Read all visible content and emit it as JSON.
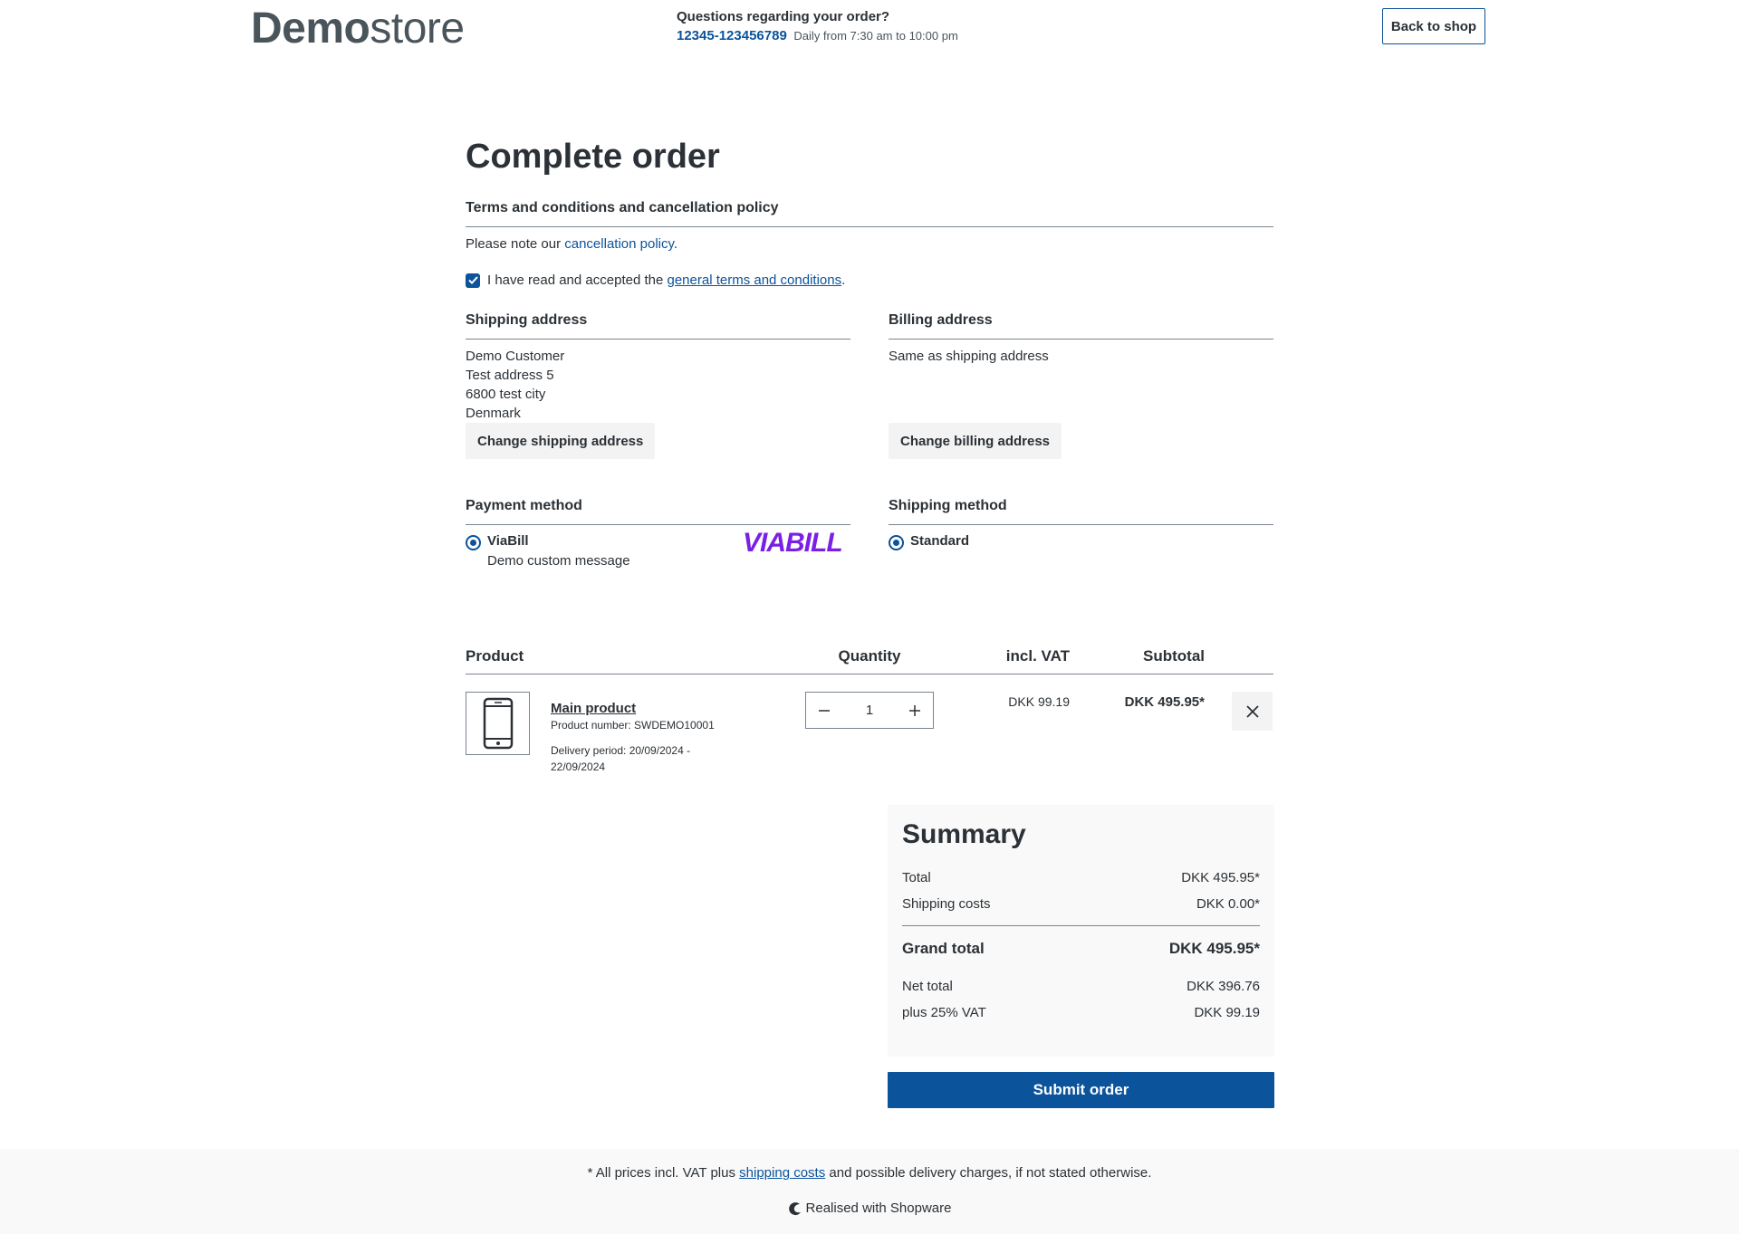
{
  "header": {
    "logo_bold": "Demo",
    "logo_light": "store",
    "hotline_title": "Questions regarding your order?",
    "hotline_phone": "12345-123456789",
    "hotline_hours": "Daily from 7:30 am to 10:00 pm",
    "back_to_shop": "Back to shop"
  },
  "page": {
    "title": "Complete order"
  },
  "terms": {
    "title": "Terms and conditions and cancellation policy",
    "note_prefix": "Please note our ",
    "cancellation_link": "cancellation policy",
    "note_suffix": ".",
    "accept_prefix": "I have read and accepted the ",
    "terms_link": "general terms and conditions",
    "accept_suffix": ".",
    "accepted": true
  },
  "shipping_address": {
    "title": "Shipping address",
    "lines": [
      "Demo Customer",
      "Test address 5",
      "6800 test city",
      "Denmark"
    ],
    "change_button": "Change shipping address"
  },
  "billing_address": {
    "title": "Billing address",
    "text": "Same as shipping address",
    "change_button": "Change billing address"
  },
  "payment": {
    "title": "Payment method",
    "method_name": "ViaBill",
    "method_message": "Demo custom message",
    "logo_text": "VIABILL",
    "logo_color": "#7b1fe6"
  },
  "shipping_method": {
    "title": "Shipping method",
    "method_name": "Standard"
  },
  "cart": {
    "headers": {
      "product": "Product",
      "quantity": "Quantity",
      "incl_vat": "incl. VAT",
      "subtotal": "Subtotal"
    },
    "items": [
      {
        "name": "Main product",
        "product_number": "Product number: SWDEMO10001",
        "delivery_line1": "Delivery period: 20/09/2024 -",
        "delivery_line2": "22/09/2024",
        "quantity": "1",
        "vat": "DKK 99.19",
        "subtotal": "DKK 495.95*",
        "icon": "smartphone-icon"
      }
    ]
  },
  "summary": {
    "title": "Summary",
    "total_label": "Total",
    "total_value": "DKK 495.95*",
    "shipping_label": "Shipping costs",
    "shipping_value": "DKK 0.00*",
    "grand_label": "Grand total",
    "grand_value": "DKK 495.95*",
    "net_label": "Net total",
    "net_value": "DKK 396.76",
    "vat_label": "plus 25% VAT",
    "vat_value": "DKK 99.19",
    "submit": "Submit order"
  },
  "footer": {
    "note_prefix": "* All prices incl. VAT plus ",
    "shipping_link": "shipping costs",
    "note_suffix": " and possible delivery charges, if not stated otherwise.",
    "brand": "Realised with Shopware"
  },
  "colors": {
    "primary": "#0b539b",
    "text": "#2b3136",
    "light_bg": "#f9f9f9",
    "button_bg": "#f3f3f3"
  }
}
